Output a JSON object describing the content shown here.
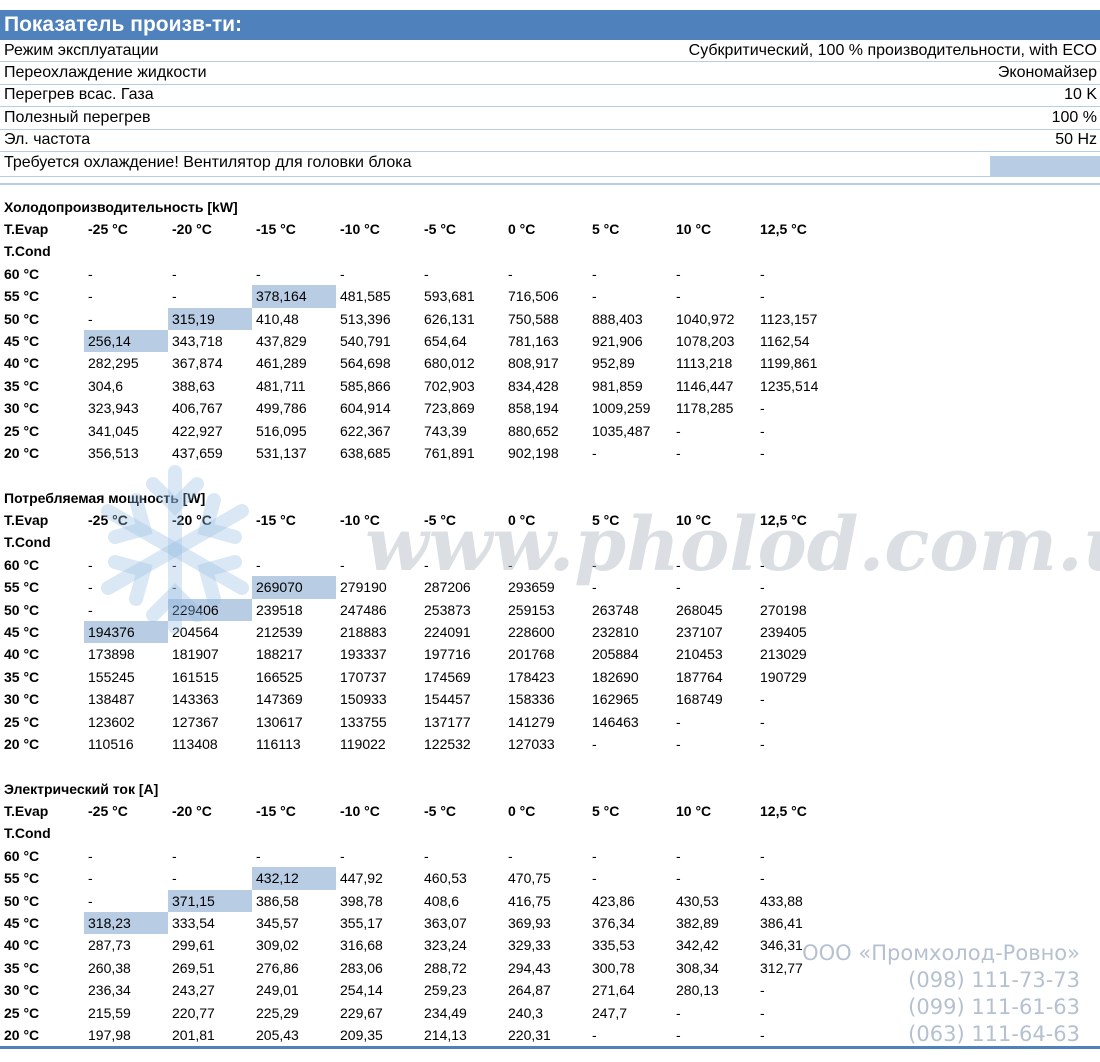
{
  "header": {
    "title": "Показатель произв-ти:"
  },
  "info": {
    "rows": [
      {
        "label": "Режим эксплуатации",
        "value": "Субкритический, 100 % производительности, with ECO"
      },
      {
        "label": "Переохлаждение жидкости",
        "value": "Экономайзер"
      },
      {
        "label": "Перегрев всас. Газа",
        "value": "10 K"
      },
      {
        "label": "Полезный перегрев",
        "value": "100 %"
      },
      {
        "label": "Эл. частота",
        "value": "50 Hz"
      }
    ],
    "warning": "Требуется охлаждение! Вентилятор для головки блока"
  },
  "colors": {
    "header_bg": "#4f81bd",
    "highlight": "#b8cce4"
  },
  "sections": [
    {
      "title": "Холодопроизводительность [kW]",
      "corner_label": "T.Evap",
      "row_label": "T.Cond",
      "columns": [
        "-25 °C",
        "-20 °C",
        "-15 °C",
        "-10 °C",
        "-5 °C",
        "0 °C",
        "5 °C",
        "10 °C",
        "12,5 °C"
      ],
      "rows": [
        {
          "label": "60 °C",
          "values": [
            "-",
            "-",
            "-",
            "-",
            "-",
            "-",
            "-",
            "-",
            "-"
          ],
          "highlight": -1
        },
        {
          "label": "55 °C",
          "values": [
            "-",
            "-",
            "378,164",
            "481,585",
            "593,681",
            "716,506",
            "-",
            "-",
            "-"
          ],
          "highlight": 2
        },
        {
          "label": "50 °C",
          "values": [
            "-",
            "315,19",
            "410,48",
            "513,396",
            "626,131",
            "750,588",
            "888,403",
            "1040,972",
            "1123,157"
          ],
          "highlight": 1
        },
        {
          "label": "45 °C",
          "values": [
            "256,14",
            "343,718",
            "437,829",
            "540,791",
            "654,64",
            "781,163",
            "921,906",
            "1078,203",
            "1162,54"
          ],
          "highlight": 0
        },
        {
          "label": "40 °C",
          "values": [
            "282,295",
            "367,874",
            "461,289",
            "564,698",
            "680,012",
            "808,917",
            "952,89",
            "1113,218",
            "1199,861"
          ],
          "highlight": -1
        },
        {
          "label": "35 °C",
          "values": [
            "304,6",
            "388,63",
            "481,711",
            "585,866",
            "702,903",
            "834,428",
            "981,859",
            "1146,447",
            "1235,514"
          ],
          "highlight": -1
        },
        {
          "label": "30 °C",
          "values": [
            "323,943",
            "406,767",
            "499,786",
            "604,914",
            "723,869",
            "858,194",
            "1009,259",
            "1178,285",
            "-"
          ],
          "highlight": -1
        },
        {
          "label": "25 °C",
          "values": [
            "341,045",
            "422,927",
            "516,095",
            "622,367",
            "743,39",
            "880,652",
            "1035,487",
            "-",
            "-"
          ],
          "highlight": -1
        },
        {
          "label": "20 °C",
          "values": [
            "356,513",
            "437,659",
            "531,137",
            "638,685",
            "761,891",
            "902,198",
            "-",
            "-",
            "-"
          ],
          "highlight": -1
        }
      ]
    },
    {
      "title": "Потребляемая мощность [W]",
      "corner_label": "T.Evap",
      "row_label": "T.Cond",
      "columns": [
        "-25 °C",
        "-20 °C",
        "-15 °C",
        "-10 °C",
        "-5 °C",
        "0 °C",
        "5 °C",
        "10 °C",
        "12,5 °C"
      ],
      "rows": [
        {
          "label": "60 °C",
          "values": [
            "-",
            "-",
            "-",
            "-",
            "-",
            "-",
            "-",
            "-",
            "-"
          ],
          "highlight": -1
        },
        {
          "label": "55 °C",
          "values": [
            "-",
            "-",
            "269070",
            "279190",
            "287206",
            "293659",
            "-",
            "-",
            "-"
          ],
          "highlight": 2
        },
        {
          "label": "50 °C",
          "values": [
            "-",
            "229406",
            "239518",
            "247486",
            "253873",
            "259153",
            "263748",
            "268045",
            "270198"
          ],
          "highlight": 1
        },
        {
          "label": "45 °C",
          "values": [
            "194376",
            "204564",
            "212539",
            "218883",
            "224091",
            "228600",
            "232810",
            "237107",
            "239405"
          ],
          "highlight": 0
        },
        {
          "label": "40 °C",
          "values": [
            "173898",
            "181907",
            "188217",
            "193337",
            "197716",
            "201768",
            "205884",
            "210453",
            "213029"
          ],
          "highlight": -1
        },
        {
          "label": "35 °C",
          "values": [
            "155245",
            "161515",
            "166525",
            "170737",
            "174569",
            "178423",
            "182690",
            "187764",
            "190729"
          ],
          "highlight": -1
        },
        {
          "label": "30 °C",
          "values": [
            "138487",
            "143363",
            "147369",
            "150933",
            "154457",
            "158336",
            "162965",
            "168749",
            "-"
          ],
          "highlight": -1
        },
        {
          "label": "25 °C",
          "values": [
            "123602",
            "127367",
            "130617",
            "133755",
            "137177",
            "141279",
            "146463",
            "-",
            "-"
          ],
          "highlight": -1
        },
        {
          "label": "20 °C",
          "values": [
            "110516",
            "113408",
            "116113",
            "119022",
            "122532",
            "127033",
            "-",
            "-",
            "-"
          ],
          "highlight": -1
        }
      ]
    },
    {
      "title": "Электрический ток [A]",
      "corner_label": "T.Evap",
      "row_label": "T.Cond",
      "columns": [
        "-25 °C",
        "-20 °C",
        "-15 °C",
        "-10 °C",
        "-5 °C",
        "0 °C",
        "5 °C",
        "10 °C",
        "12,5 °C"
      ],
      "rows": [
        {
          "label": "60 °C",
          "values": [
            "-",
            "-",
            "-",
            "-",
            "-",
            "-",
            "-",
            "-",
            "-"
          ],
          "highlight": -1
        },
        {
          "label": "55 °C",
          "values": [
            "-",
            "-",
            "432,12",
            "447,92",
            "460,53",
            "470,75",
            "-",
            "-",
            "-"
          ],
          "highlight": 2
        },
        {
          "label": "50 °C",
          "values": [
            "-",
            "371,15",
            "386,58",
            "398,78",
            "408,6",
            "416,75",
            "423,86",
            "430,53",
            "433,88"
          ],
          "highlight": 1
        },
        {
          "label": "45 °C",
          "values": [
            "318,23",
            "333,54",
            "345,57",
            "355,17",
            "363,07",
            "369,93",
            "376,34",
            "382,89",
            "386,41"
          ],
          "highlight": 0
        },
        {
          "label": "40 °C",
          "values": [
            "287,73",
            "299,61",
            "309,02",
            "316,68",
            "323,24",
            "329,33",
            "335,53",
            "342,42",
            "346,31"
          ],
          "highlight": -1
        },
        {
          "label": "35 °C",
          "values": [
            "260,38",
            "269,51",
            "276,86",
            "283,06",
            "288,72",
            "294,43",
            "300,78",
            "308,34",
            "312,77"
          ],
          "highlight": -1
        },
        {
          "label": "30 °C",
          "values": [
            "236,34",
            "243,27",
            "249,01",
            "254,14",
            "259,23",
            "264,87",
            "271,64",
            "280,13",
            "-"
          ],
          "highlight": -1
        },
        {
          "label": "25 °C",
          "values": [
            "215,59",
            "220,77",
            "225,29",
            "229,67",
            "234,49",
            "240,3",
            "247,7",
            "-",
            "-"
          ],
          "highlight": -1
        },
        {
          "label": "20 °C",
          "values": [
            "197,98",
            "201,81",
            "205,43",
            "209,35",
            "214,13",
            "220,31",
            "-",
            "-",
            "-"
          ],
          "highlight": -1
        }
      ]
    }
  ],
  "watermark": {
    "text": "www.pholod.com.ua",
    "icon": "snowflake-icon"
  },
  "contact": {
    "company": "ООО «Промхолод-Ровно»",
    "phones": [
      "(098) 111-73-73",
      "(099) 111-61-63",
      "(063) 111-64-63"
    ]
  }
}
